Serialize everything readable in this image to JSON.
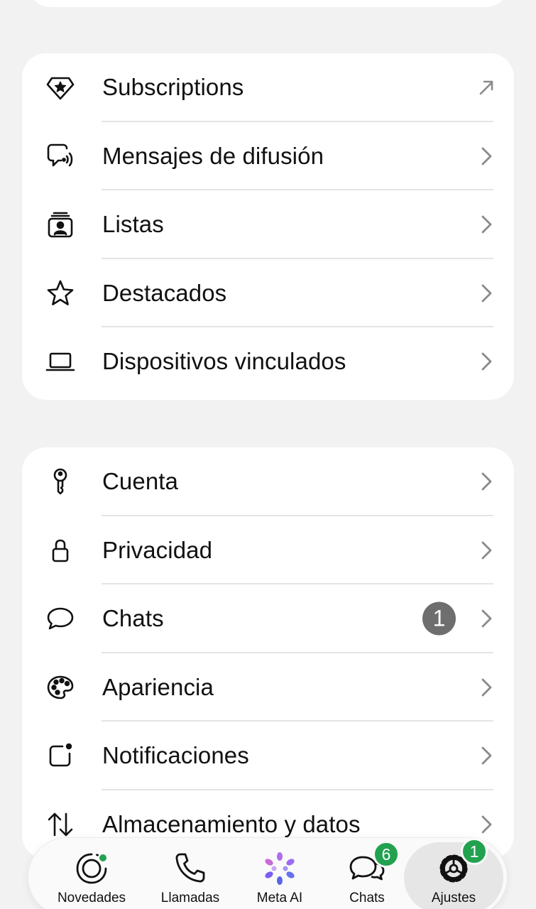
{
  "section1": {
    "items": [
      {
        "label": "Subscriptions",
        "icon": "subscriptions-diamond-star-icon",
        "action": "external-arrow-icon"
      },
      {
        "label": "Mensajes de difusión",
        "icon": "broadcast-message-icon",
        "action": "chevron-right-icon"
      },
      {
        "label": "Listas",
        "icon": "lists-contact-card-icon",
        "action": "chevron-right-icon"
      },
      {
        "label": "Destacados",
        "icon": "star-icon",
        "action": "chevron-right-icon"
      },
      {
        "label": "Dispositivos vinculados",
        "icon": "laptop-icon",
        "action": "chevron-right-icon"
      }
    ]
  },
  "section2": {
    "items": [
      {
        "label": "Cuenta",
        "icon": "key-icon"
      },
      {
        "label": "Privacidad",
        "icon": "lock-icon"
      },
      {
        "label": "Chats",
        "icon": "chat-bubble-icon",
        "badge": "1"
      },
      {
        "label": "Apariencia",
        "icon": "palette-icon"
      },
      {
        "label": "Notificaciones",
        "icon": "notification-square-icon"
      },
      {
        "label": "Almacenamiento y datos",
        "icon": "up-down-arrows-icon"
      }
    ]
  },
  "tabbar": {
    "tabs": [
      {
        "label": "Novedades",
        "icon": "updates-icon",
        "dot": true
      },
      {
        "label": "Llamadas",
        "icon": "phone-icon"
      },
      {
        "label": "Meta AI",
        "icon": "meta-ai-icon"
      },
      {
        "label": "Chats",
        "icon": "chats-bubbles-icon",
        "badge": "6"
      },
      {
        "label": "Ajustes",
        "icon": "settings-gear-icon",
        "badge": "1",
        "selected": true
      }
    ]
  },
  "colors": {
    "background": "#f2f2f2",
    "card": "#ffffff",
    "accent_green": "#22a14f",
    "badge_gray": "#6e6e6e"
  }
}
